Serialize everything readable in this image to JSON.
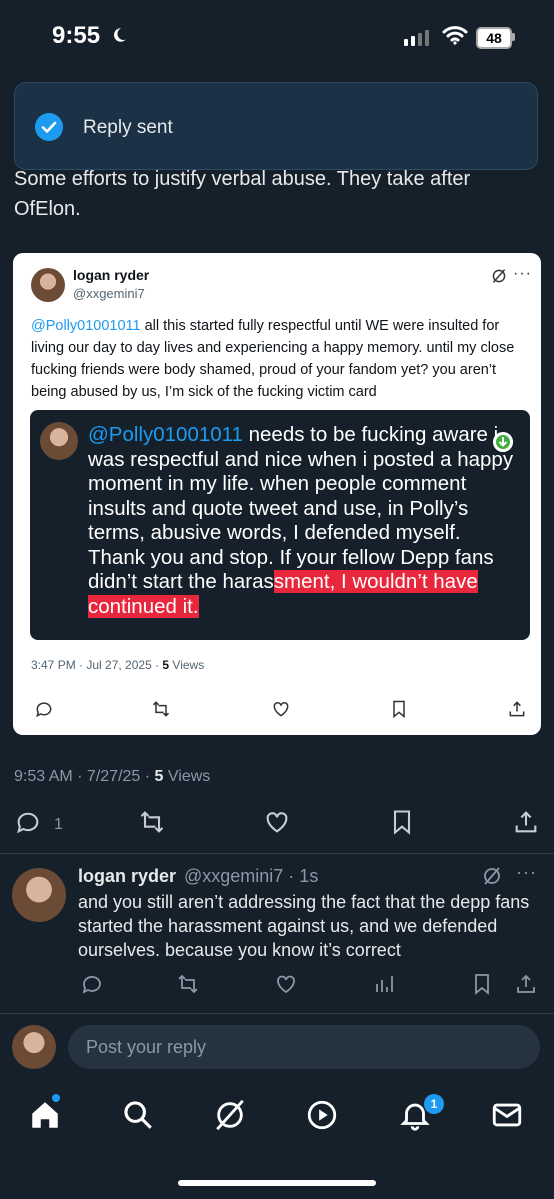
{
  "status_bar": {
    "time": "9:55",
    "battery": "48"
  },
  "toast": {
    "text": "Reply sent"
  },
  "tweet": {
    "text": "Some efforts to justify verbal abuse. They take after OfElon.",
    "timestamp": "9:53 AM · 7/27/25 · ",
    "views_count": "5",
    "views_label": " Views",
    "reply_count": "1"
  },
  "quoted": {
    "name": "logan ryder",
    "handle": "@xxgemini7",
    "mention": "@Polly01001011",
    "text": " all this started fully respectful until WE were insulted for living our day to day lives and experiencing a happy memory. until my close fucking friends were body shamed, proud of your fandom yet? you aren’t being abused by us, I’m sick of the fucking victim card",
    "inner": {
      "mention": "@Polly01001011",
      "text_plain": " needs to be fucking aware i was respectful and nice when i posted a happy moment in my life. when people comment insults and quote tweet and use, in Polly’s terms, abusive words, I defended myself. Thank you and stop. If your fellow Depp fans didn’t start the haras",
      "text_highlight": "sment, I wouldn’t have continued it."
    },
    "timestamp": "3:47 PM · Jul 27, 2025 · ",
    "views_count": "5",
    "views_label": " Views"
  },
  "reply": {
    "name": "logan ryder",
    "handle": "@xxgemini7 · 1s",
    "text": "and you still aren’t addressing the fact that the depp fans started the harassment against us, and we defended ourselves. because you know it’s correct"
  },
  "composer": {
    "placeholder": "Post your reply"
  },
  "nav": {
    "notification_badge": "1"
  },
  "colors": {
    "background": "#15202b",
    "accent": "#1d9bf0",
    "highlight": "#e8263c"
  }
}
